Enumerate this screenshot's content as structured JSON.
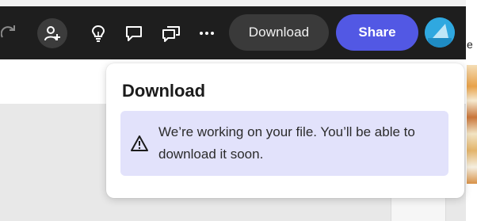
{
  "toolbar": {
    "download_label": "Download",
    "share_label": "Share",
    "icons": [
      "redo-icon",
      "add-collaborator-icon",
      "lightbulb-icon",
      "comment-icon",
      "comments-icon",
      "more-icon"
    ]
  },
  "popover": {
    "title": "Download",
    "message": "We’re working on your file. You’ll be able to download it soon."
  },
  "right_panel": {
    "partial_text": "e"
  },
  "colors": {
    "toolbar_bg": "#1e1e1e",
    "share_bg": "#5258e4",
    "download_bg": "#3a3a3a",
    "notice_bg": "#e2e2fb",
    "avatar": "#2fa8e0"
  }
}
